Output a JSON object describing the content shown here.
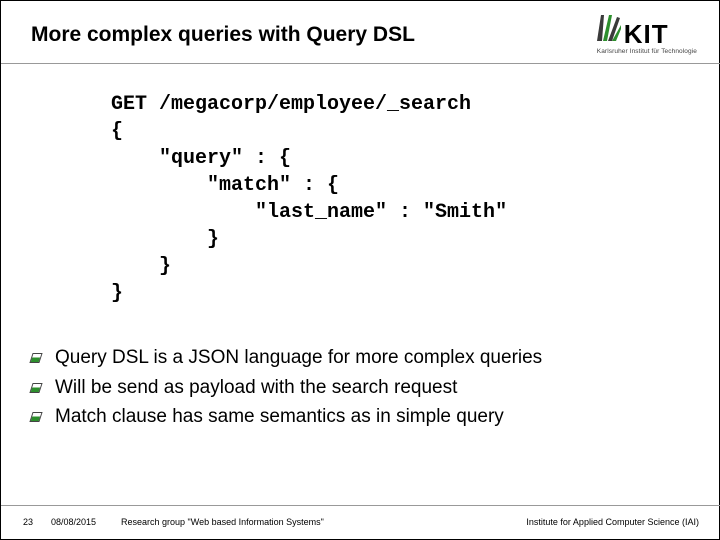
{
  "header": {
    "title": "More complex queries with Query DSL"
  },
  "logo": {
    "text": "KIT",
    "subtitle": "Karlsruher Institut für Technologie"
  },
  "code": {
    "line1": "GET /megacorp/employee/_search",
    "line2": "{",
    "line3": "    \"query\" : {",
    "line4": "        \"match\" : {",
    "line5": "            \"last_name\" : \"Smith\"",
    "line6": "        }",
    "line7": "    }",
    "line8": "}"
  },
  "bullets": {
    "items": [
      {
        "text": "Query DSL is a JSON language for more complex queries"
      },
      {
        "text": "Will be send as payload with the search request"
      },
      {
        "text": "Match clause has same semantics as in simple query"
      }
    ]
  },
  "footer": {
    "page": "23",
    "date": "08/08/2015",
    "group": "Research group \"Web based Information Systems\"",
    "institute": "Institute for Applied Computer Science (IAI)"
  }
}
